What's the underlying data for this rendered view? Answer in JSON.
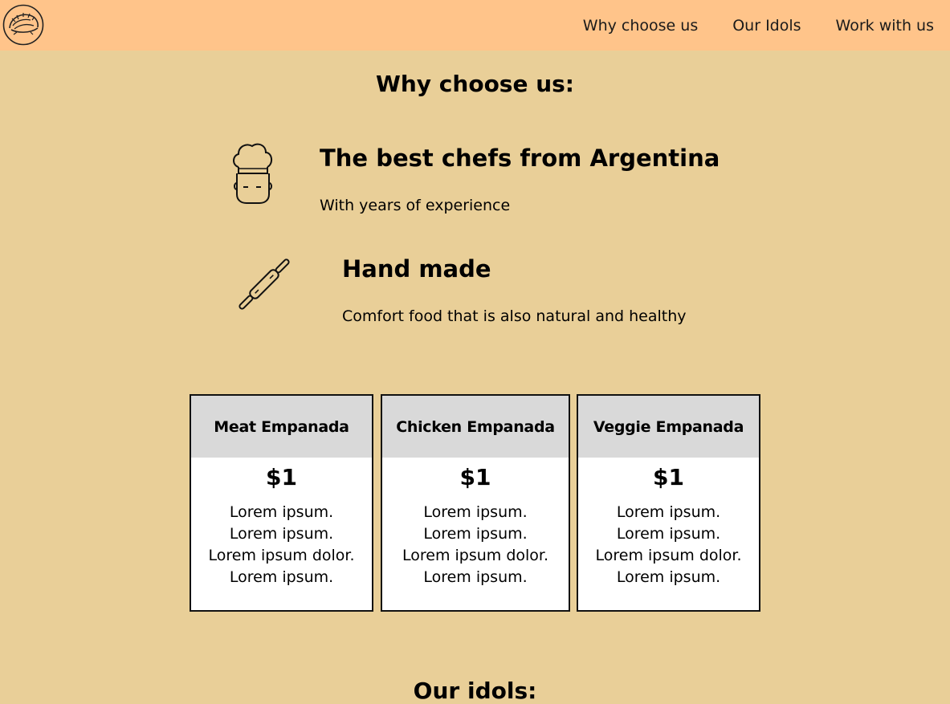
{
  "header": {
    "logo_icon": "empanada-logo-icon",
    "nav": [
      {
        "label": "Why choose us"
      },
      {
        "label": "Our Idols"
      },
      {
        "label": "Work with us"
      }
    ],
    "background": "#ffc48a"
  },
  "why": {
    "title": "Why choose us:",
    "features": [
      {
        "icon": "chef-icon",
        "title": "The best chefs from Argentina",
        "text": "With years of experience"
      },
      {
        "icon": "rolling-pin-icon",
        "title": "Hand made",
        "text": "Comfort food that is also natural and healthy"
      }
    ]
  },
  "products": [
    {
      "name": "Meat Empanada",
      "price": "$1",
      "lines": [
        "Lorem ipsum.",
        "Lorem ipsum.",
        "Lorem ipsum dolor.",
        "Lorem ipsum."
      ]
    },
    {
      "name": "Chicken Empanada",
      "price": "$1",
      "lines": [
        "Lorem ipsum.",
        "Lorem ipsum.",
        "Lorem ipsum dolor.",
        "Lorem ipsum."
      ]
    },
    {
      "name": "Veggie Empanada",
      "price": "$1",
      "lines": [
        "Lorem ipsum.",
        "Lorem ipsum.",
        "Lorem ipsum dolor.",
        "Lorem ipsum."
      ]
    }
  ],
  "idols": {
    "title": "Our idols:"
  },
  "colors": {
    "page_background": "#e9cf98",
    "header_background": "#ffc48a",
    "card_header": "#d9d9d9"
  }
}
